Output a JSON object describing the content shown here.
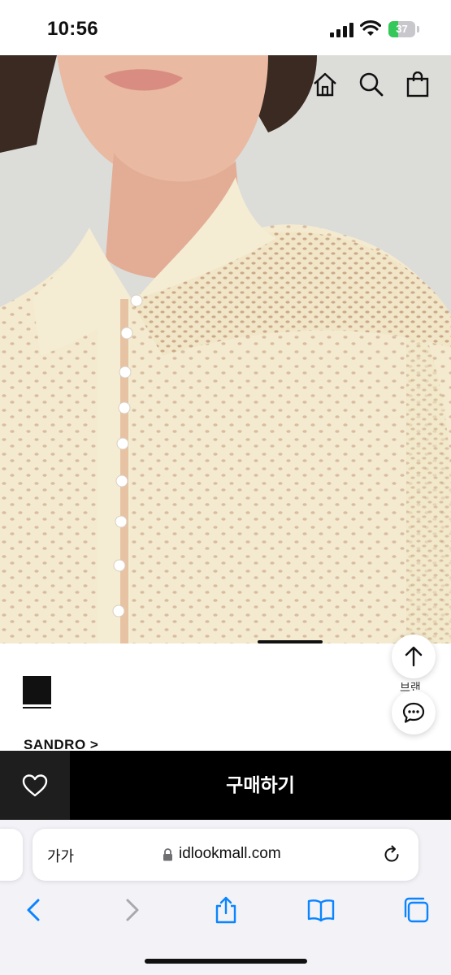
{
  "status_bar": {
    "time": "10:56",
    "battery_percent": "37",
    "battery_level": 0.37,
    "battery_color": "#34c759"
  },
  "header_icons": [
    "home-icon",
    "search-icon",
    "shopping-bag-icon"
  ],
  "product": {
    "brand": "SANDRO >",
    "image_description_icon": "product-photo"
  },
  "floating": {
    "scroll_top_icon": "arrow-up-icon",
    "partial_label": "브랜",
    "chat_icon": "chat-bubble-icon"
  },
  "purchase_bar": {
    "wishlist_icon": "heart-icon",
    "buy_label": "구매하기",
    "background": "#000000"
  },
  "browser": {
    "text_size_label": "가가",
    "url": "idlookmall.com",
    "reload_icon": "reload-icon",
    "toolbar_icons": [
      "back-icon",
      "forward-icon",
      "share-icon",
      "bookmarks-icon",
      "tabs-icon"
    ],
    "accent": "#0a84ff"
  }
}
